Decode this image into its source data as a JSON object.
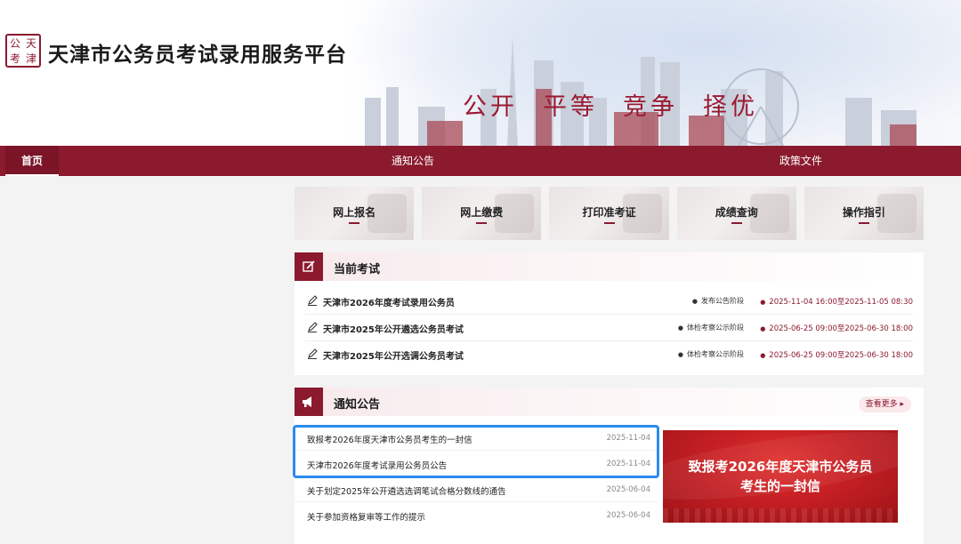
{
  "header": {
    "logo_chars": [
      "公",
      "天",
      "考",
      "津"
    ],
    "site_title": "天津市公务员考试录用服务平台",
    "slogan": [
      "公开",
      "平等",
      "竞争",
      "择优"
    ]
  },
  "nav": {
    "home": "首页",
    "notices": "通知公告",
    "policy": "政策文件"
  },
  "tiles": [
    {
      "label": "网上报名"
    },
    {
      "label": "网上缴费"
    },
    {
      "label": "打印准考证"
    },
    {
      "label": "成绩查询"
    },
    {
      "label": "操作指引"
    }
  ],
  "current_exams": {
    "title": "当前考试",
    "rows": [
      {
        "name": "天津市2026年度考试录用公务员",
        "stage": "发布公告阶段",
        "time": "2025-11-04 16:00至2025-11-05 08:30"
      },
      {
        "name": "天津市2025年公开遴选公务员考试",
        "stage": "体检考察公示阶段",
        "time": "2025-06-25 09:00至2025-06-30 18:00"
      },
      {
        "name": "天津市2025年公开选调公务员考试",
        "stage": "体检考察公示阶段",
        "time": "2025-06-25 09:00至2025-06-30 18:00"
      }
    ]
  },
  "notices": {
    "title": "通知公告",
    "more_label": "查看更多",
    "items": [
      {
        "title": "致报考2026年度天津市公务员考生的一封信",
        "date": "2025-11-04"
      },
      {
        "title": "天津市2026年度考试录用公务员公告",
        "date": "2025-11-04"
      },
      {
        "title": "关于划定2025年公开遴选选调笔试合格分数线的通告",
        "date": "2025-06-04"
      },
      {
        "title": "关于参加资格复审等工作的提示",
        "date": "2025-06-04"
      }
    ],
    "banner_lines": [
      "致报考2026年度天津市公务员",
      "考生的一封信"
    ]
  },
  "colors": {
    "brand": "#8b1a2e",
    "highlight": "#2a8cf0"
  }
}
